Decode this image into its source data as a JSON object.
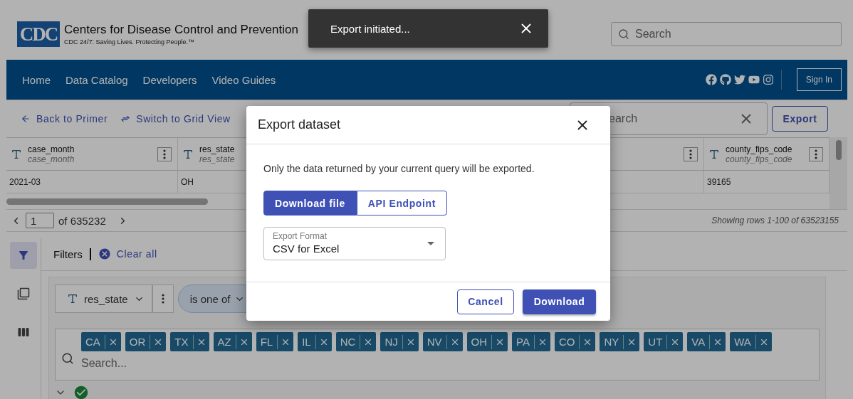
{
  "toast": {
    "message": "Export initiated..."
  },
  "header": {
    "logo": "CDC",
    "title": "Centers for Disease Control and Prevention",
    "tagline": "CDC 24/7: Saving Lives. Protecting People.™",
    "search": {
      "placeholder": "Search"
    }
  },
  "nav": {
    "items": [
      "Home",
      "Data Catalog",
      "Developers",
      "Video Guides"
    ],
    "sign_in": "Sign In"
  },
  "toolbar": {
    "back": "Back to Primer",
    "switch": "Switch to Grid View",
    "search": {
      "placeholder": "earch"
    },
    "export": "Export"
  },
  "table": {
    "columns": [
      {
        "kind": "text",
        "name": "case_month",
        "field": "case_month"
      },
      {
        "kind": "text_cut",
        "name": "res_state",
        "field": "res_state"
      },
      {
        "kind": "covered"
      },
      {
        "kind": "text",
        "name": "county_fips_code",
        "field": "county_fips_code"
      }
    ],
    "rows": [
      {
        "cells": [
          "2021-03",
          "OH",
          "39165"
        ]
      }
    ]
  },
  "pagination": {
    "page": "1",
    "of": "of 635232",
    "summary": "Showing rows 1-100 of 63523155"
  },
  "side_tools": [
    {
      "kind": "filter",
      "selected": true
    },
    {
      "kind": "group",
      "selected": false
    },
    {
      "kind": "columns",
      "selected": false
    }
  ],
  "filters": {
    "title": "Filters",
    "clear": "Clear all",
    "field": "res_state",
    "operator": "is one of",
    "values": [
      "CA",
      "OR",
      "TX",
      "AZ",
      "FL",
      "IL",
      "NC",
      "NJ",
      "NV",
      "OH",
      "PA",
      "CO",
      "NY",
      "UT",
      "VA",
      "WA"
    ],
    "search_placeholder": "Search..."
  },
  "modal": {
    "title": "Export dataset",
    "note": "Only the data returned by your current query will be exported.",
    "tabs": [
      {
        "label": "Download file",
        "selected": true
      },
      {
        "label": "API Endpoint",
        "selected": false
      }
    ],
    "format": {
      "label": "Export Format",
      "value": "CSV for Excel"
    },
    "cancel": "Cancel",
    "download": "Download"
  }
}
